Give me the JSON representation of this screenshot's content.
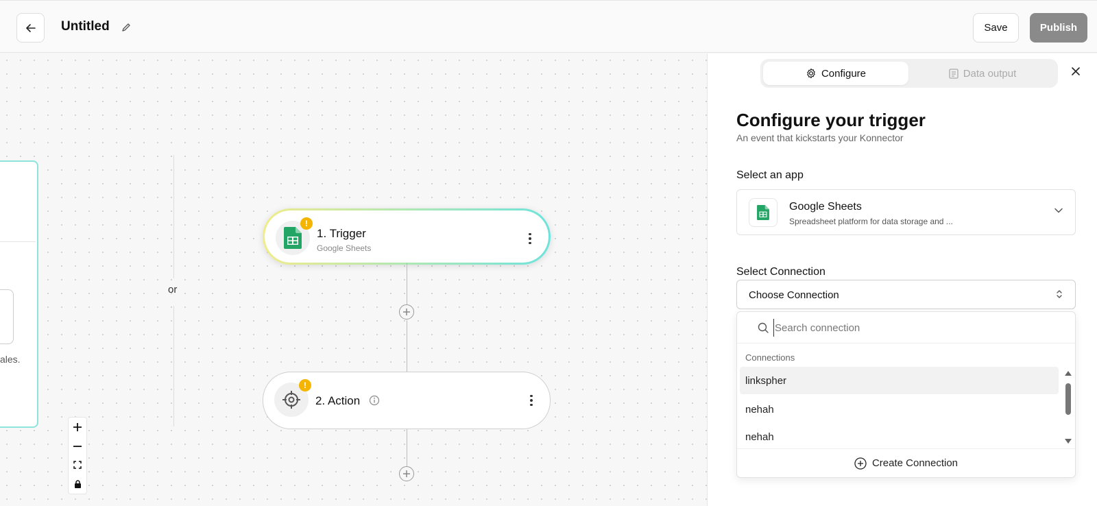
{
  "header": {
    "title": "Untitled",
    "save_label": "Save",
    "publish_label": "Publish"
  },
  "canvas": {
    "or_label": "or",
    "left_card_text": "ales.",
    "trigger": {
      "title": "1. Trigger",
      "subtitle": "Google Sheets",
      "badge": "!"
    },
    "action": {
      "title": "2. Action",
      "badge": "!"
    }
  },
  "panel": {
    "tabs": [
      {
        "label": "Configure",
        "icon": "gear-icon",
        "active": true
      },
      {
        "label": "Data output",
        "icon": "document-icon",
        "active": false
      }
    ],
    "heading": "Configure your trigger",
    "subheading": "An event that kickstarts your Konnector",
    "select_app_label": "Select an app",
    "app": {
      "name": "Google Sheets",
      "description": "Spreadsheet platform for data storage and ..."
    },
    "select_connection_label": "Select Connection",
    "connection_placeholder": "Choose Connection",
    "dropdown": {
      "search_placeholder": "Search connection",
      "group_label": "Connections",
      "items": [
        "linkspher",
        "nehah",
        "nehah"
      ],
      "create_label": "Create Connection"
    }
  },
  "colors": {
    "publish_bg": "#8a8a8a",
    "sheets_green": "#23a566",
    "warning": "#f4b400",
    "trigger_gradient_start": "#f0ec8a",
    "trigger_gradient_end": "#6ee3dc"
  }
}
